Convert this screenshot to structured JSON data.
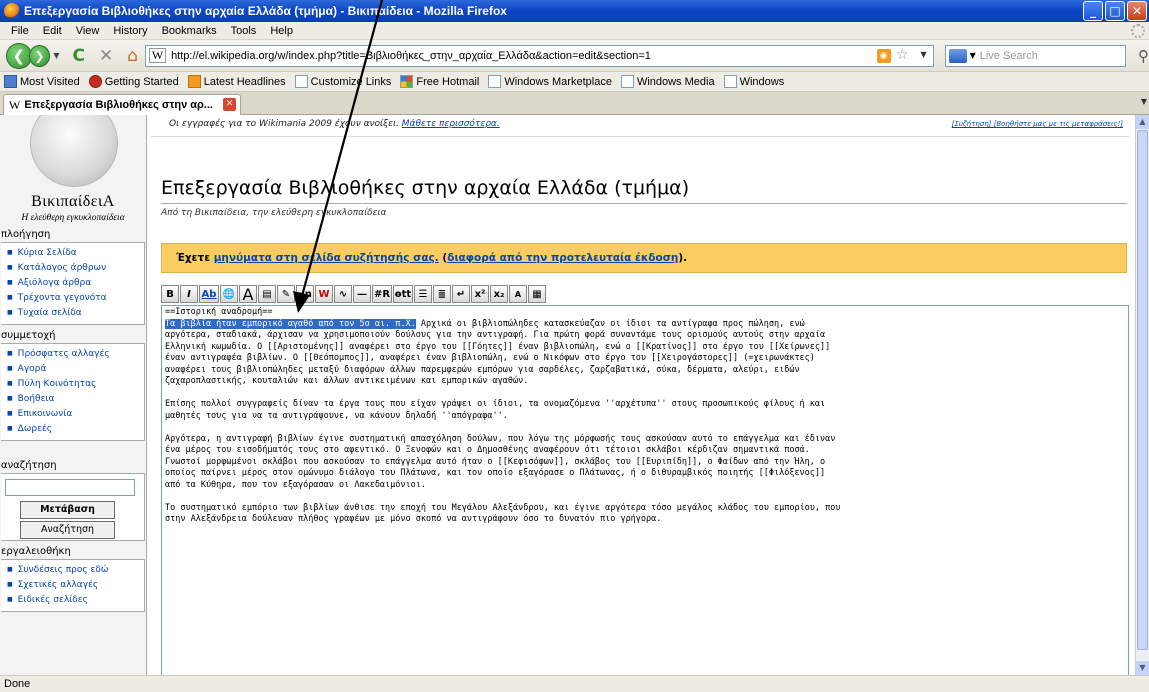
{
  "window": {
    "title": "Επεξεργασία Βιβλιοθήκες στην αρχαία Ελλάδα (τμήμα) - Βικιπαίδεια - Mozilla Firefox",
    "minimize": "_",
    "maximize": "□",
    "close": "✕"
  },
  "menu": [
    "File",
    "Edit",
    "View",
    "History",
    "Bookmarks",
    "Tools",
    "Help"
  ],
  "nav": {
    "url": "http://el.wikipedia.org/w/index.php?title=Βιβλιοθήκες_στην_αρχαία_Ελλάδα&action=edit&section=1",
    "search_placeholder": "Live Search"
  },
  "bookmarks": [
    "Most Visited",
    "Getting Started",
    "Latest Headlines",
    "Customize Links",
    "Free Hotmail",
    "Windows Marketplace",
    "Windows Media",
    "Windows"
  ],
  "tab": {
    "title": "Επεξεργασία Βιβλιοθήκες στην αρ..."
  },
  "logo": {
    "name": "ΒικιπαίδειΑ",
    "slogan": "Η ελεύθερη εγκυκλοπαίδεια"
  },
  "sidebar": {
    "nav_heading": "πλοήγηση",
    "nav_items": [
      "Κύρια Σελίδα",
      "Κατάλογος άρθρων",
      "Αξιόλογα άρθρα",
      "Τρέχοντα γεγονότα",
      "Τυχαία σελίδα"
    ],
    "participation_heading": "συμμετοχή",
    "participation_items": [
      "Πρόσφατες αλλαγές",
      "Αγορά",
      "Πύλη Κοινότητας",
      "Βοήθεια",
      "Επικοινωνία",
      "Δωρεές"
    ],
    "search_heading": "αναζήτηση",
    "go_button": "Μετάβαση",
    "search_button": "Αναζήτηση",
    "toolbox_heading": "εργαλειοθήκη",
    "toolbox_items": [
      "Συνδέσεις προς εδώ",
      "Σχετικές αλλαγές",
      "Ειδικές σελίδες"
    ]
  },
  "notice": {
    "text": "Οι εγγραφές για το Wikimania 2009 έχουν ανοίξει. ",
    "link": "Μάθετε περισσότερα.",
    "right": "[Συζήτηση] [Βοηθήστε μας με τις μεταφράσεις!]"
  },
  "page": {
    "title": "Επεξεργασία Βιβλιοθήκες στην αρχαία Ελλάδα (τμήμα)",
    "from": "Από τη Βικιπαίδεια, την ελεύθερη εγκυκλοπαίδεια"
  },
  "message": {
    "prefix": "Έχετε ",
    "link1": "μηνύματα στη σελίδα συζήτησής σας.",
    "middle": " (",
    "link2": "διαφορά από την προτελευταία έκδοση",
    "suffix": ")."
  },
  "edit_toolbar": [
    "B",
    "I",
    "Ab",
    "🌐",
    "A",
    "▤",
    "✎",
    "√n",
    "W",
    "∿",
    "—",
    "#R",
    "ɵtt",
    "☰",
    "≣",
    "↵",
    "x²",
    "x₂",
    "A",
    "▦"
  ],
  "editor": {
    "heading_line": "==Ιστορική αναδρομή==",
    "selected": "Τα βιβλία ήταν εμπορικό αγαθό από τον 5ο αι. π.Χ.",
    "line1_rest": " Αρχικά οι βιβλιοπώληδες κατασκεύαζαν οι ίδιοι τα αντίγραφα προς πώληση, ενώ",
    "lines": [
      "αργότερα, σταδιακά, άρχισαν να χρησιμοποιούν δούλους για την αντιγραφή. Για πρώτη φορά συναντάμε τους ορισμούς αυτούς στην αρχαία",
      "Ελληνική κωμωδία. Ο [[Αριστομένης]] αναφέρει στο έργο του [[Γόητες]] έναν βιβλιοπώλη, ενώ ο [[Κρατίνος]] στο έργο του [[Χείρωνες]]",
      "έναν αντιγραφέα βιβλίων. Ο [[Θεόπομπος]], αναφέρει έναν βιβλιοπώλη, ενώ ο Νικόφων στο έργο του [[Χειρογάστορες]] (=χειρωνάκτες)",
      "αναφέρει τους βιβλιοπώληδες μεταξύ διαφόρων άλλων παρεμφερών εμπόρων για σαρδέλες, ζαρζαβατικά, σύκα, δέρματα, αλεύρι, ειδών",
      "ζαχαροπλαστικής, κουταλιών και άλλων αντικειμένων και εμπορικών αγαθών.",
      "",
      "Επίσης πολλοί συγγραφείς δίναν τα έργα τους που είχαν γράψει οι ίδιοι, τα ονομαζόμενα ''αρχέτυπα'' στους προσωπικούς φίλους ή και",
      "μαθητές τους για να τα αντιγράψουνε, να κάνουν δηλαδή ''απόγραφα''.",
      "",
      "Αργότερα, η αντιγραφή βιβλίων έγινε συστηματική απασχόληση δούλων, που λόγω της μόρφωσής τους ασκούσαν αυτό το επάγγελμα και έδιναν",
      "ένα μέρος του εισοδήματός τους στο αφεντικό. Ο Ξενοφών και ο Δημοσθένης αναφέρουν ότι τέτοιοι σκλάβοι κέρδιζαν σημαντικά ποσά.",
      "Γνωστοί μορφωμένοι σκλάβοι που ασκούσαν το επάγγελμα αυτό ήταν ο [[Κεφισόφων]], σκλάβος του [[Ευριπίδη]], ο Φαίδων από την Ήλη, ο",
      "οποίος παίρνει μέρος στον ομώνυμο διάλογο του Πλάτωνα, και τον οποίο εξαγόρασε ο Πλάτωνας, ή ο διθυραμβικός ποιητής [[Φιλόξενος]]",
      "από τα Κύθηρα, που τον εξαγόρασαν οι Λακεδαιμόνιοι.",
      "",
      "Το συστηματικό εμπόριο των βιβλίων άνθισε την εποχή του Μεγάλου Αλεξάνδρου, και έγινε αργότερα τόσο μεγάλος κλάδος του εμπορίου, που",
      "στην Αλεξάνδρεια δούλευαν πλήθος γραφέων με μόνο σκοπό να αντιγράφουν όσο το δυνατόν πιο γρήγορα."
    ]
  },
  "status": "Done",
  "colors": {
    "selection": "#316ac5",
    "message_bg": "#fbcc5f",
    "link": "#0645ad"
  }
}
